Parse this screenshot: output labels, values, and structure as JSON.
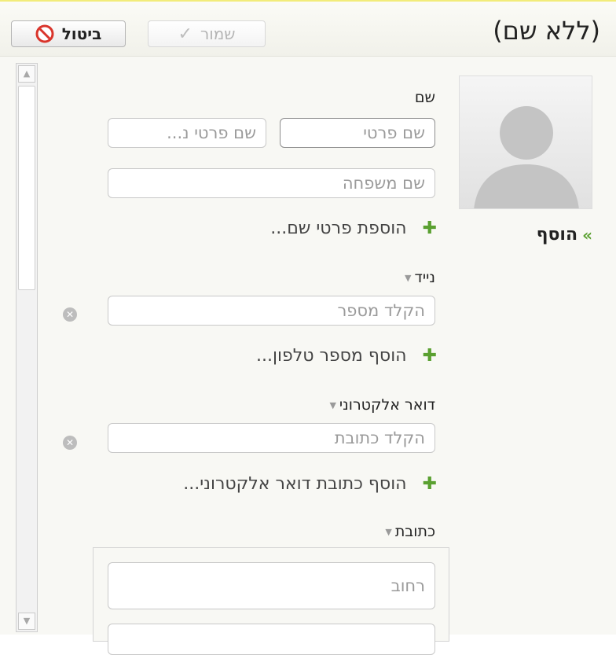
{
  "header": {
    "title": "(ללא שם)",
    "cancel_label": "ביטול",
    "save_label": "שמור"
  },
  "sidebar": {
    "add_link_label": "הוסף"
  },
  "name_section": {
    "label": "שם",
    "first_name_placeholder": "שם פרטי",
    "middle_name_placeholder": "שם פרטי נ...",
    "last_name_placeholder": "שם משפחה",
    "add_name_details": "הוספת פרטי שם..."
  },
  "phone_section": {
    "label": "נייד",
    "number_placeholder": "הקלד מספר",
    "add_phone": "הוסף מספר טלפון..."
  },
  "email_section": {
    "label": "דואר אלקטרוני",
    "address_placeholder": "הקלד כתובת",
    "add_email": "הוסף כתובת דואר אלקטרוני..."
  },
  "address_section": {
    "label": "כתובת",
    "street_placeholder": "רחוב"
  },
  "colors": {
    "accent_green": "#5aa030",
    "cancel_red": "#d9342b",
    "top_border": "#f2ec7a"
  }
}
